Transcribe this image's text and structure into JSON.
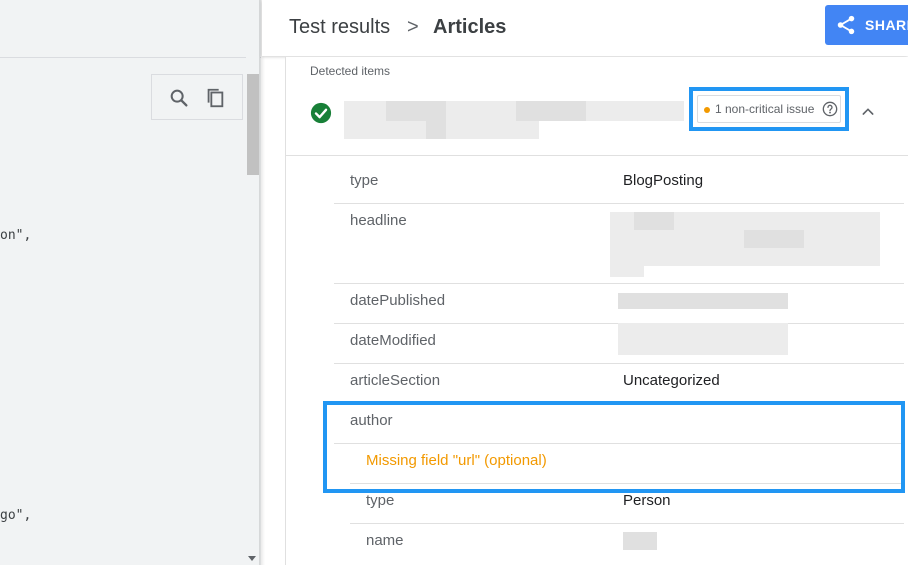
{
  "header": {
    "breadcrumb_parent": "Test results",
    "breadcrumb_separator": ">",
    "breadcrumb_current": "Articles",
    "share_label": "SHARE"
  },
  "code_panel": {
    "fragments": [
      "on\",",
      "go\","
    ]
  },
  "detected": {
    "label": "Detected items",
    "issue_text": "1 non-critical issue"
  },
  "properties": {
    "type": {
      "name": "type",
      "value": "BlogPosting"
    },
    "headline": {
      "name": "headline"
    },
    "datePublished": {
      "name": "datePublished"
    },
    "dateModified": {
      "name": "dateModified"
    },
    "articleSection": {
      "name": "articleSection",
      "value": "Uncategorized"
    },
    "author": {
      "name": "author",
      "warning": "Missing field \"url\" (optional)",
      "type": {
        "name": "type",
        "value": "Person"
      },
      "person_name": {
        "name": "name"
      }
    }
  },
  "colors": {
    "accent": "#4285f4",
    "highlight": "#2196f3",
    "warning": "#f29900",
    "valid": "#188038"
  },
  "icons": [
    "search-icon",
    "copy-icon",
    "share-icon",
    "check-circle-icon",
    "help-icon",
    "chevron-up-icon"
  ]
}
